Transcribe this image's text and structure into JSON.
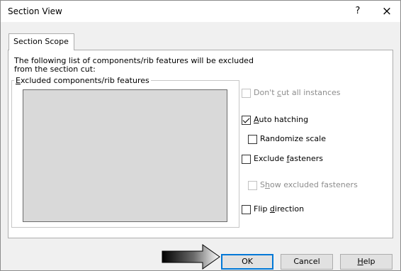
{
  "window": {
    "title": "Section View",
    "help_symbol": "?",
    "close_symbol": "×"
  },
  "tabs": [
    {
      "label": "Section Scope",
      "active": true
    }
  ],
  "description": {
    "line1": "The following list of components/rib features will be excluded",
    "line2": "from the section cut:"
  },
  "group": {
    "label_prefix": "",
    "label_mnemonic": "E",
    "label_rest": "xcluded components/rib features"
  },
  "options": {
    "dont_cut": {
      "pre": "Don't ",
      "mn": "c",
      "post": "ut all instances",
      "checked": false,
      "enabled": false
    },
    "auto_hatching": {
      "pre": "",
      "mn": "A",
      "post": "uto hatching",
      "checked": true,
      "enabled": true
    },
    "randomize_scale": {
      "pre": "Randomize scale",
      "mn": "",
      "post": "",
      "checked": false,
      "enabled": true
    },
    "exclude_fasteners": {
      "pre": "Exclude ",
      "mn": "f",
      "post": "asteners",
      "checked": false,
      "enabled": true
    },
    "show_excluded": {
      "pre": "S",
      "mn": "h",
      "post": "ow excluded fasteners",
      "checked": false,
      "enabled": false
    },
    "flip_direction": {
      "pre": "Flip ",
      "mn": "d",
      "post": "irection",
      "checked": false,
      "enabled": true
    }
  },
  "buttons": {
    "ok": "OK",
    "cancel": "Cancel",
    "help_pre": "",
    "help_mn": "H",
    "help_post": "elp"
  },
  "colors": {
    "accent": "#0078d7",
    "listbox_bg": "#d9d9d9"
  },
  "icons": {
    "pointer_arrow": "arrow-right-gradient-icon"
  }
}
